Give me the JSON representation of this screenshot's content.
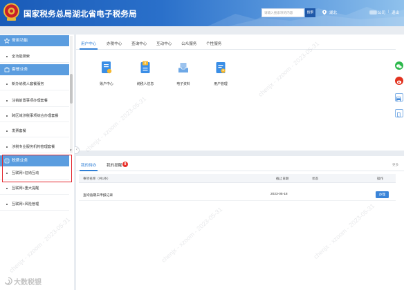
{
  "header": {
    "title": "国家税务总局湖北省电子税务局",
    "search_placeholder": "请输入搜索项的内容",
    "search_button": "搜索",
    "region": "湖北",
    "company": "公司",
    "separator": "|",
    "logout": "退出"
  },
  "sidebar": {
    "sections": [
      {
        "title": "常用功能",
        "icon": "star-icon",
        "items": [
          "全功能搜索"
        ]
      },
      {
        "title": "套餐业务",
        "icon": "package-icon",
        "items": [
          "新办纳税人套餐服务",
          "注销前置事项办理套餐",
          "跨区域涉税事项综合办理套餐",
          "发票套餐",
          "涉税专业服务机构管理套餐"
        ]
      },
      {
        "title": "税费业务",
        "icon": "tax-business-icon",
        "items": [
          "互联网+征纳互动",
          "互联网+重大提醒",
          "互联网+风险管理"
        ]
      }
    ]
  },
  "main": {
    "tabs": [
      {
        "label": "用户中心",
        "active": true
      },
      {
        "label": "办税中心"
      },
      {
        "label": "查询中心"
      },
      {
        "label": "互动中心"
      },
      {
        "label": "公众服务"
      },
      {
        "label": "个性服务"
      }
    ],
    "shortcuts": [
      {
        "label": "账户中心",
        "icon": "account-icon"
      },
      {
        "label": "纳税人信息",
        "icon": "taxpayer-info-icon"
      },
      {
        "label": "电子资料",
        "icon": "e-documents-icon"
      },
      {
        "label": "用户管理",
        "icon": "user-management-icon"
      }
    ]
  },
  "tasks": {
    "tabs": [
      {
        "label": "我的待办",
        "active": true
      },
      {
        "label": "我的提醒",
        "badge": "8"
      }
    ],
    "more": "更多",
    "columns": [
      "事项名称（共1条）",
      "截止日期",
      "状态",
      "操作"
    ],
    "rows": [
      {
        "name": "查询逾期未申报记录",
        "deadline": "2023-05-18",
        "action": "办理"
      }
    ]
  },
  "side_toolbar": [
    "wechat-icon",
    "weibo-icon",
    "print-icon",
    "phone-icon"
  ],
  "watermark": {
    "text": "chenjx - xzoom - 2023-05-31"
  },
  "brand_watermark": {
    "text": "大数税银"
  },
  "colors": {
    "header": "#1a5bb8",
    "primary": "#2f7fd6",
    "sidebar_header": "#5b9ddf",
    "alert": "#e8302a",
    "highlight_box": "#e3242b"
  }
}
